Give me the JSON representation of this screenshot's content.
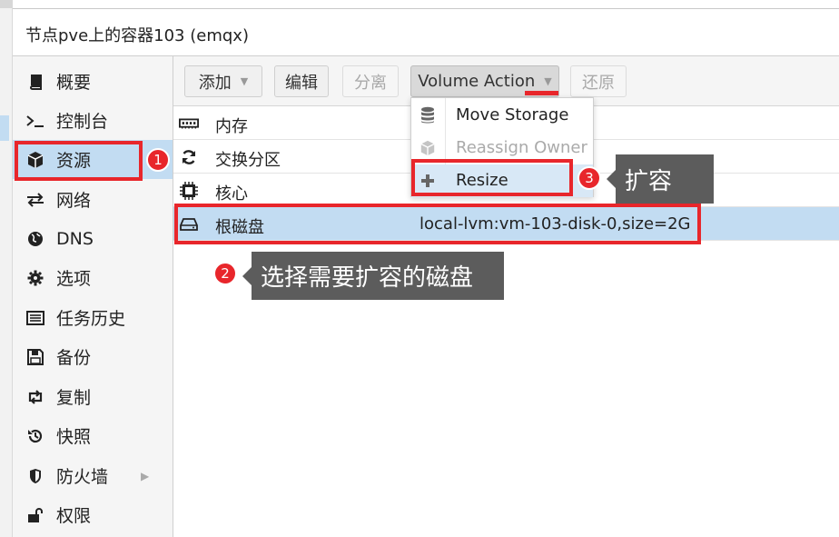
{
  "window": {
    "title": "节点pve上的容器103 (emqx)"
  },
  "sidebar": {
    "items": [
      {
        "label": "概要",
        "icon": "book-icon"
      },
      {
        "label": "控制台",
        "icon": "terminal-icon"
      },
      {
        "label": "资源",
        "icon": "cube-icon",
        "active": true
      },
      {
        "label": "网络",
        "icon": "exchange-icon"
      },
      {
        "label": "DNS",
        "icon": "globe-icon"
      },
      {
        "label": "选项",
        "icon": "gear-icon"
      },
      {
        "label": "任务历史",
        "icon": "list-icon"
      },
      {
        "label": "备份",
        "icon": "save-icon"
      },
      {
        "label": "复制",
        "icon": "retweet-icon"
      },
      {
        "label": "快照",
        "icon": "history-icon"
      },
      {
        "label": "防火墙",
        "icon": "shield-icon"
      },
      {
        "label": "权限",
        "icon": "unlock-icon"
      }
    ]
  },
  "toolbar": {
    "add": "添加",
    "edit": "编辑",
    "detach": "分离",
    "volume_action": "Volume Action",
    "revert": "还原"
  },
  "resources": {
    "rows": [
      {
        "name": "内存",
        "value": "",
        "icon": "memory-icon"
      },
      {
        "name": "交换分区",
        "value": "",
        "icon": "refresh-icon"
      },
      {
        "name": "核心",
        "value": "",
        "icon": "cpu-icon"
      },
      {
        "name": "根磁盘",
        "value": "local-lvm:vm-103-disk-0,size=2G",
        "icon": "hdd-icon",
        "selected": true
      }
    ]
  },
  "volume_menu": {
    "items": [
      {
        "label": "Move Storage",
        "icon": "database-icon",
        "enabled": true
      },
      {
        "label": "Reassign Owner",
        "icon": "cube-icon",
        "enabled": false
      },
      {
        "label": "Resize",
        "icon": "plus-icon",
        "enabled": true,
        "hover": true
      }
    ]
  },
  "annotations": {
    "step1": "1",
    "step2": "2",
    "step3": "3",
    "tip2": "选择需要扩容的磁盘",
    "tip3": "扩容",
    "color": "#e8262b"
  },
  "colors": {
    "selection": "#c2dcf2",
    "tooltip_bg": "#5c5c5c"
  }
}
